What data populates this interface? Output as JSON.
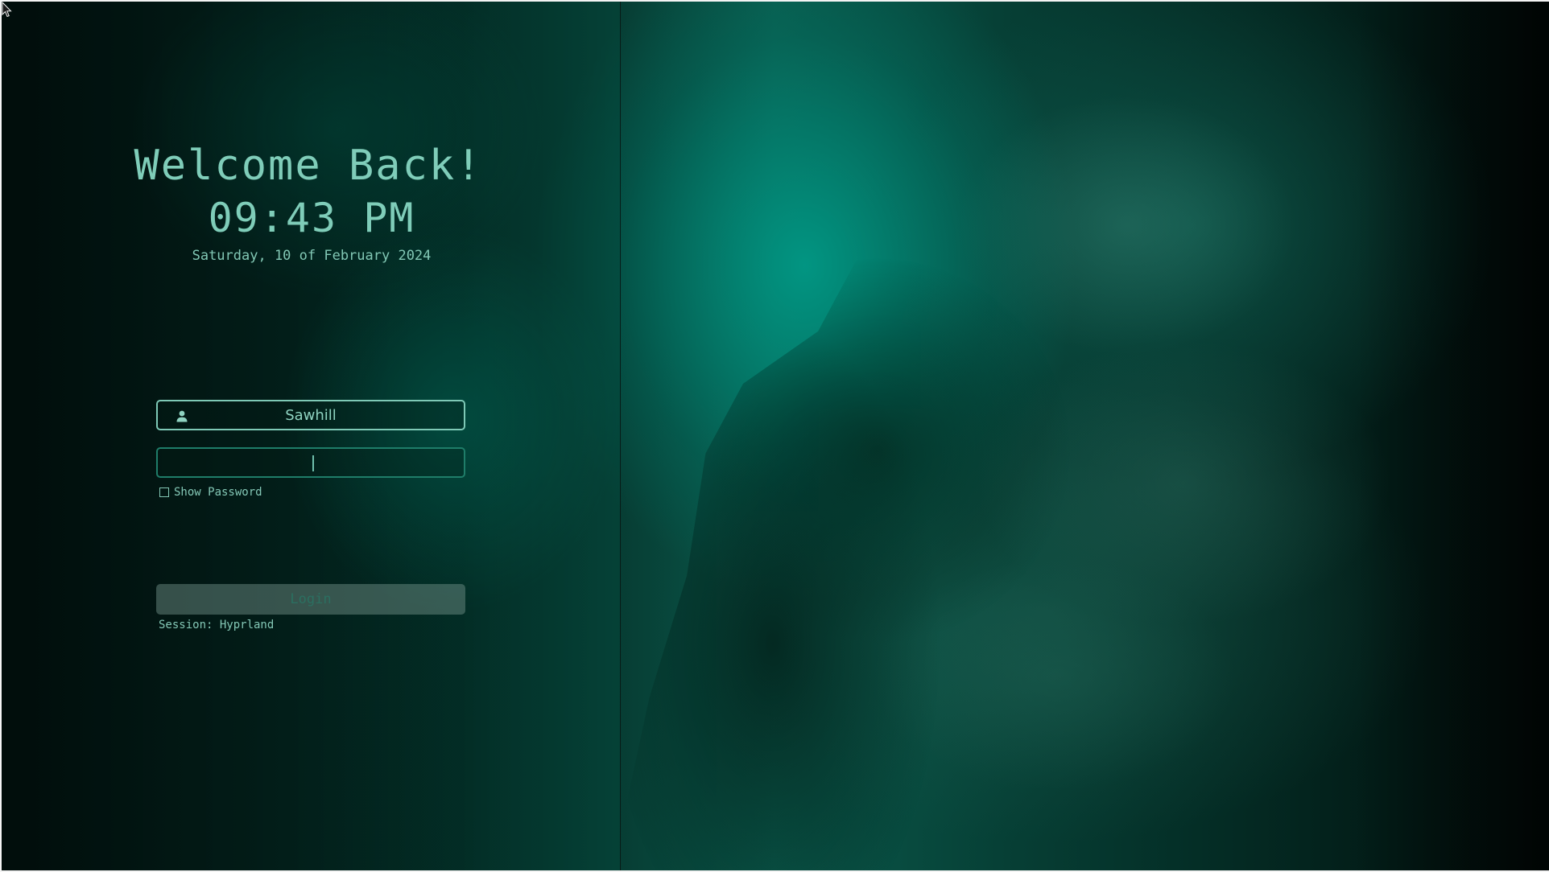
{
  "greeting": "Welcome Back!",
  "clock": "09:43 PM",
  "date": "Saturday, 10 of February 2024",
  "login_form": {
    "username": "Sawhill",
    "username_icon": "user-icon",
    "password_value": "",
    "show_password_label": "Show Password",
    "show_password_checked": false,
    "login_label": "Login",
    "session_label": "Session: Hyprland"
  },
  "colors": {
    "accent": "#7fcdb9",
    "background": "#03201b"
  }
}
